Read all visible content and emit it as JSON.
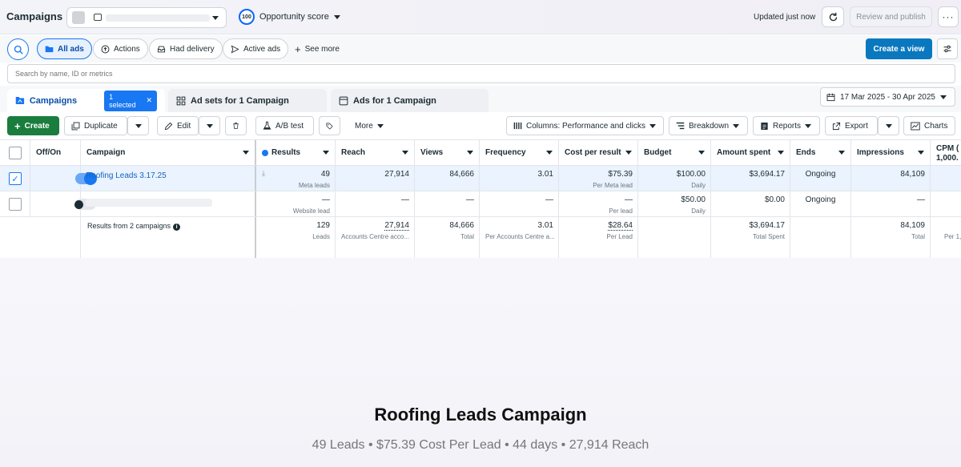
{
  "topbar": {
    "title": "Campaigns",
    "opportunity_score": "100",
    "opportunity_label": "Opportunity score",
    "updated": "Updated just now",
    "review_publish": "Review and publish",
    "more": "···"
  },
  "filters": {
    "chips": [
      "All ads",
      "Actions",
      "Had delivery",
      "Active ads"
    ],
    "see_more": "See more",
    "create_view": "Create a view",
    "search_placeholder": "Search by name, ID or metrics"
  },
  "tabs": {
    "campaigns": "Campaigns",
    "selected": "1 selected",
    "adsets": "Ad sets for 1 Campaign",
    "ads": "Ads for 1 Campaign",
    "date_range": "17 Mar 2025 - 30 Apr 2025"
  },
  "toolbar": {
    "create": "Create",
    "duplicate": "Duplicate",
    "edit": "Edit",
    "ab_test": "A/B test",
    "more": "More",
    "columns": "Columns: Performance and clicks",
    "breakdown": "Breakdown",
    "reports": "Reports",
    "export": "Export",
    "charts": "Charts"
  },
  "table": {
    "headers": {
      "offon": "Off/On",
      "campaign": "Campaign",
      "results": "Results",
      "reach": "Reach",
      "views": "Views",
      "frequency": "Frequency",
      "cpr": "Cost per result",
      "budget": "Budget",
      "spent": "Amount spent",
      "ends": "Ends",
      "impressions": "Impressions",
      "cpm": "CPM (",
      "cpm2": "1,000."
    },
    "row1": {
      "campaign": "Roofing Leads 3.17.25",
      "results": "49",
      "results_sub": "Meta leads",
      "reach": "27,914",
      "views": "84,666",
      "frequency": "3.01",
      "cpr": "$75.39",
      "cpr_sub": "Per Meta lead",
      "budget": "$100.00",
      "budget_sub": "Daily",
      "spent": "$3,694.17",
      "ends": "Ongoing",
      "impressions": "84,109"
    },
    "row2": {
      "results": "—",
      "results_sub": "Website lead",
      "reach": "—",
      "views": "—",
      "frequency": "—",
      "cpr": "—",
      "cpr_sub": "Per lead",
      "budget": "$50.00",
      "budget_sub": "Daily",
      "spent": "$0.00",
      "ends": "Ongoing",
      "impressions": "—"
    },
    "summary": {
      "label": "Results from 2 campaigns",
      "results": "129",
      "results_sub": "Leads",
      "reach": "27,914",
      "reach_sub": "Accounts Centre acco...",
      "views": "84,666",
      "views_sub": "Total",
      "frequency": "3.01",
      "frequency_sub": "Per Accounts Centre a...",
      "cpr": "$28.64",
      "cpr_sub": "Per Lead",
      "spent": "$3,694.17",
      "spent_sub": "Total Spent",
      "impressions": "84,109",
      "impressions_sub": "Total",
      "cpm_sub": "Per 1,"
    }
  },
  "caption": {
    "headline": "Roofing Leads Campaign",
    "subline": "49 Leads • $75.39 Cost Per Lead • 44 days • 27,914 Reach"
  }
}
